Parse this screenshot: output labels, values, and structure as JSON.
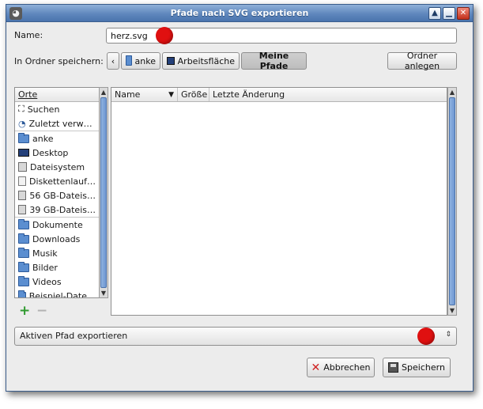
{
  "window": {
    "title": "Pfade nach SVG exportieren",
    "app_icon": "gimp-wilber-icon"
  },
  "name_field": {
    "label": "Name:",
    "value": "herz.svg"
  },
  "folder": {
    "label": "In Ordner speichern:",
    "path": [
      {
        "label": "anke",
        "icon": "home-folder-icon"
      },
      {
        "label": "Arbeitsfläche",
        "icon": "desktop-icon"
      },
      {
        "label": "Meine Pfade",
        "icon": "",
        "active": true
      }
    ],
    "create_folder_label": "Ordner anlegen"
  },
  "places": {
    "header": "Orte",
    "items": [
      {
        "label": "Suchen",
        "icon": "binoculars-icon"
      },
      {
        "label": "Zuletzt verw…",
        "icon": "recent-icon"
      },
      {
        "label": "anke",
        "icon": "home-folder-icon"
      },
      {
        "label": "Desktop",
        "icon": "desktop-icon"
      },
      {
        "label": "Dateisystem",
        "icon": "harddisk-icon"
      },
      {
        "label": "Diskettenlauf…",
        "icon": "floppy-icon"
      },
      {
        "label": "56 GB-Dateis…",
        "icon": "harddisk-icon"
      },
      {
        "label": "39 GB-Dateis…",
        "icon": "harddisk-icon"
      },
      {
        "label": "Dokumente",
        "icon": "folder-icon"
      },
      {
        "label": "Downloads",
        "icon": "folder-icon"
      },
      {
        "label": "Musik",
        "icon": "folder-icon"
      },
      {
        "label": "Bilder",
        "icon": "folder-icon"
      },
      {
        "label": "Videos",
        "icon": "folder-icon"
      },
      {
        "label": "Beispiel-Date…",
        "icon": "folder-icon"
      }
    ],
    "add_icon": "plus-icon",
    "remove_icon": "minus-icon"
  },
  "file_list": {
    "columns": [
      {
        "label": "Name"
      },
      {
        "label": "Größe"
      },
      {
        "label": "Letzte Änderung"
      }
    ],
    "rows": []
  },
  "export_select": {
    "value": "Aktiven Pfad exportieren"
  },
  "buttons": {
    "cancel": "Abbrechen",
    "save": "Speichern"
  },
  "colors": {
    "titlebar": "#5f87bd",
    "accent": "#6f98d2",
    "marker": "#e01010"
  }
}
